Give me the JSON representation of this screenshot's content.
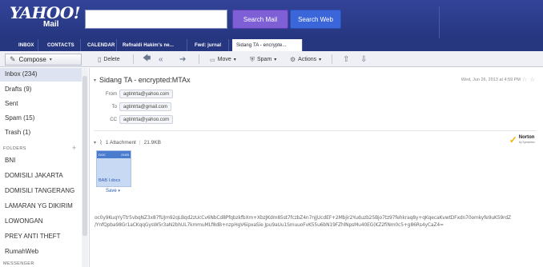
{
  "header": {
    "logo_main": "YAHOO!",
    "logo_sub": "Mail",
    "search_mail_label": "Search Mail",
    "search_web_label": "Search Web"
  },
  "tabs": [
    {
      "label": "INBOX",
      "active": false
    },
    {
      "label": "CONTACTS",
      "active": false
    },
    {
      "label": "CALENDAR",
      "active": false
    },
    {
      "label": "Refnaldi Hakim's ne...",
      "active": false
    },
    {
      "label": "Fwd: jurnal",
      "active": false
    },
    {
      "label": "Sidang TA - encrypte...",
      "active": true
    }
  ],
  "toolbar": {
    "compose_label": "Compose",
    "delete_label": "Delete",
    "move_label": "Move",
    "spam_label": "Spam",
    "actions_label": "Actions"
  },
  "sidebar": {
    "folders": [
      {
        "label": "Inbox (234)"
      },
      {
        "label": "Drafts (9)"
      },
      {
        "label": "Sent"
      },
      {
        "label": "Spam (15)"
      },
      {
        "label": "Trash (1)"
      }
    ],
    "folders_section_label": "FOLDERS",
    "user_folders": [
      {
        "label": "BNI"
      },
      {
        "label": "DOMISILI JAKARTA"
      },
      {
        "label": "DOMISILI TANGERANG"
      },
      {
        "label": "LAMARAN YG DIKIRIM"
      },
      {
        "label": "LOWONGAN"
      },
      {
        "label": "PREY ANTI THEFT"
      },
      {
        "label": "RumahWeb"
      }
    ],
    "messenger_section_label": "MESSENGER"
  },
  "message": {
    "subject": "Sidang TA - encrypted:MTAx",
    "date": "Wed, Jun 26, 2013 at 4:59 PM",
    "from_label": "From",
    "from_value": "agtintrta@yahoo.com",
    "to_label": "To",
    "to_value": "agtintrta@gmail.com",
    "cc_label": "CC",
    "cc_value": "agtintrta@yahoo.com",
    "attachment_summary": "1 Attachment",
    "attachment_size": "21.9KB",
    "attachment_type": "DOC",
    "attachment_size_small": "21KB",
    "attachment_name": "BAB I.docx",
    "save_label": "Save",
    "norton_label": "Norton",
    "norton_sub": "by Symantec",
    "body_line_1": "oc0y9KuqYyTtr5vbqNZ3x87fUJm92qLBqd2zUcCv6NbCd8PfqbzkfbXm+XbzJKdm85st7fczbZ4n7nJjUcdEF+2Mbjir2Yuduzb25Bjo7tz97fehkraq8y+qKqecaKvwtDFxdn70omkyfe9uK59rdZ",
    "body_line_2": "/YnfQpba98Gr1aCKqqGysW5r3aN2bhUL7kmmuMLf8dB+nzpHgV6ipxaSie Jpu9aUu1SmuuoFvK55u6bN19FZhlNpsMu40EG(KZ2fiNm0c5+g86Rs4yCaZ4="
  }
}
